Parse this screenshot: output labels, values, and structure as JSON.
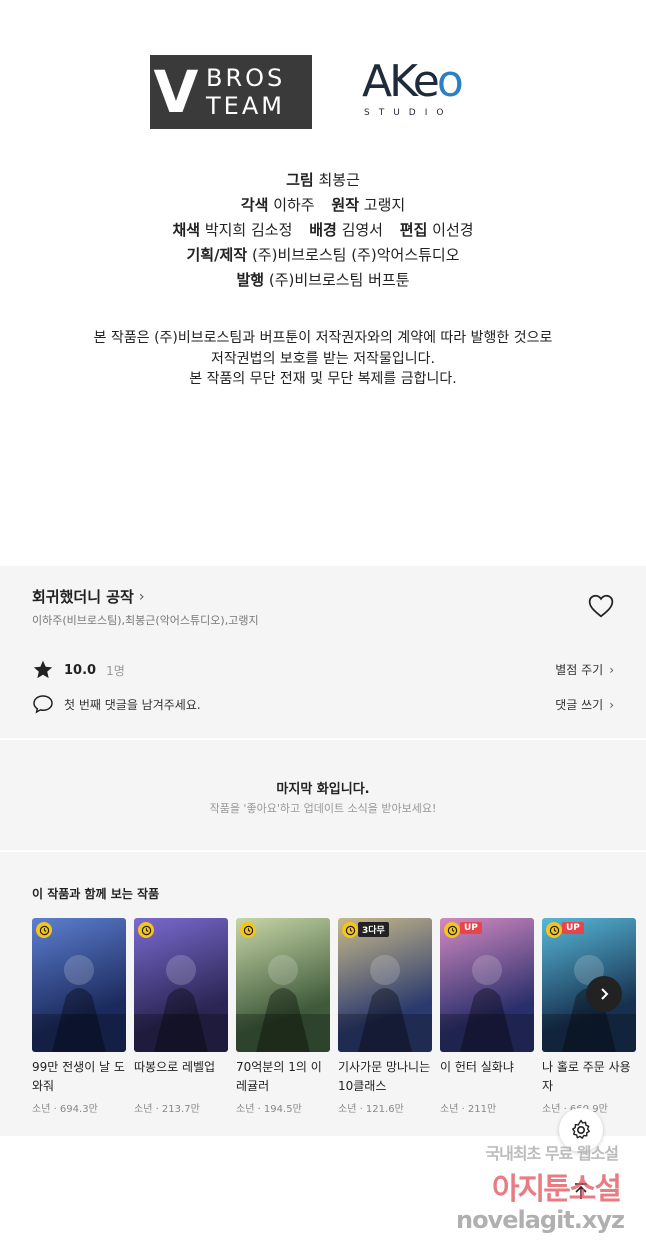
{
  "credits": {
    "logo_vbros": {
      "letter": "V",
      "line1": "BROS",
      "line2": "TEAM"
    },
    "logo_akeo": {
      "main": "AKeo",
      "sub": "STUDIO"
    },
    "line1": {
      "label": "그림",
      "value": "최봉근"
    },
    "line2": {
      "label1": "각색",
      "value1": "이하주",
      "label2": "원작",
      "value2": "고랭지"
    },
    "line3": {
      "label1": "채색",
      "value1": "박지희 김소정",
      "label2": "배경",
      "value2": "김영서",
      "label3": "편집",
      "value3": "이선경"
    },
    "line4": {
      "label": "기획/제작",
      "value": "(주)비브로스팀 (주)악어스튜디오"
    },
    "line5": {
      "label": "발행",
      "value": "(주)비브로스팀 버프툰"
    },
    "notice": [
      "본 작품은 (주)비브로스팀과 버프툰이 저작권자와의 계약에 따라 발행한 것으로",
      "저작권법의 보호를 받는 저작물입니다.",
      "본 작품의 무단 전재 및 무단 복제를 금합니다."
    ]
  },
  "work": {
    "title": "회귀했더니 공작",
    "authors": "이하주(비브로스팀),최봉근(악어스튜디오),고랭지",
    "score": "10.0",
    "raters": "1명",
    "rate_button": "별점 주기",
    "comment_prompt": "첫 번째 댓글을 남겨주세요.",
    "comment_button": "댓글 쓰기"
  },
  "last_episode": {
    "title": "마지막 화입니다.",
    "subtitle": "작품을 '좋아요'하고 업데이트 소식을 받아보세요!"
  },
  "recommendations": {
    "heading": "이 작품과 함께 보는 작품",
    "items": [
      {
        "title": "99만 전생이 날 도와줘",
        "meta": "소년 · 694.3만",
        "badge": "",
        "colors": [
          "#1b2a5c",
          "#5d7fd1"
        ]
      },
      {
        "title": "따봉으로 레벨업",
        "meta": "소년 · 213.7만",
        "badge": "",
        "colors": [
          "#2a2552",
          "#7a6ad0"
        ]
      },
      {
        "title": "70억분의 1의 이레귤러",
        "meta": "소년 · 194.5만",
        "badge": "",
        "colors": [
          "#3e5a3a",
          "#c8d6a8"
        ]
      },
      {
        "title": "기사가문 망나니는 10클래스",
        "meta": "소년 · 121.6만",
        "badge": "3다무",
        "colors": [
          "#2b3a6e",
          "#c7b98a"
        ]
      },
      {
        "title": "이 헌터 실화냐",
        "meta": "소년 · 211만",
        "badge": "UP",
        "colors": [
          "#2a2f6b",
          "#d38ac2"
        ]
      },
      {
        "title": "나 홀로 주문 사용자",
        "meta": "소년 · 660.9만",
        "badge": "UP",
        "colors": [
          "#17304f",
          "#57b8d8"
        ]
      }
    ]
  },
  "watermark": {
    "line1": "국내최초 무료 웹소설",
    "line2": "아지툰소설",
    "line3": "novelagit.xyz"
  }
}
